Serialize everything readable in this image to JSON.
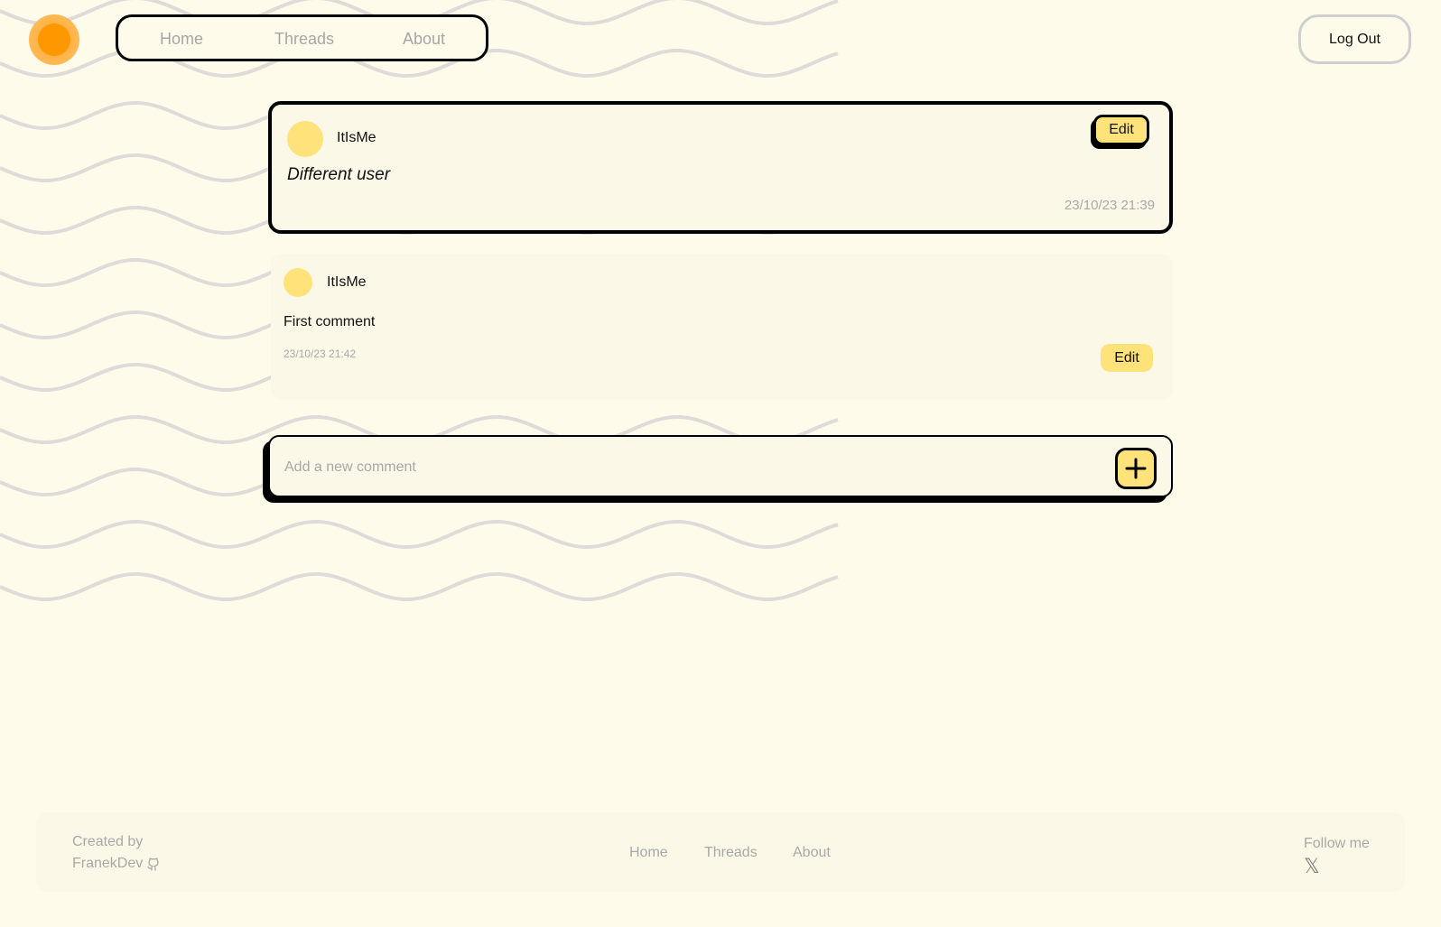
{
  "header": {
    "nav": [
      "Home",
      "Threads",
      "About"
    ],
    "logout_label": "Log Out"
  },
  "thread": {
    "username": "ItIsMe",
    "title": "Different user",
    "date": "23/10/23 21:39",
    "edit_label": "Edit"
  },
  "comment": {
    "username": "ItIsMe",
    "text": "First comment",
    "date": "23/10/23 21:42",
    "edit_label": "Edit"
  },
  "new_comment": {
    "placeholder": "Add a new comment",
    "add_icon": "plus-icon"
  },
  "footer": {
    "created_label": "Created by",
    "author": "FranekDev",
    "author_icon": "github-icon",
    "nav": [
      "Home",
      "Threads",
      "About"
    ],
    "follow_label": "Follow me",
    "follow_icon": "x-icon",
    "x_glyph": "𝕏"
  },
  "colors": {
    "background": "#fffbea",
    "card": "#fcf8e8",
    "accent": "#ffe27a",
    "logo": "#ff9800",
    "muted_text": "#a8a8a8"
  }
}
